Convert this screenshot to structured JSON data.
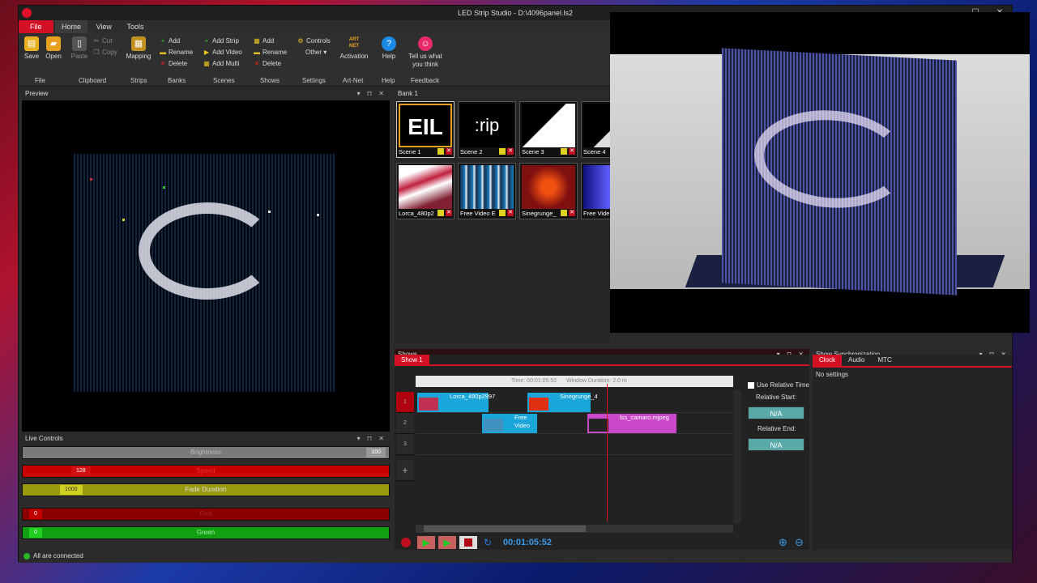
{
  "window": {
    "title": "LED Strip Studio - D:\\4096panel.ls2"
  },
  "menu": {
    "file": "File",
    "home": "Home",
    "view": "View",
    "tools": "Tools"
  },
  "ribbon": {
    "save": "Save",
    "open": "Open",
    "paste": "Paste",
    "cut": "Cut",
    "copy": "Copy",
    "mapping": "Mapping",
    "add_strip_bank": "Add",
    "rename_bank": "Rename",
    "delete_bank": "Delete",
    "add_strip": "Add Strip",
    "add_video": "Add Video",
    "add_multi": "Add Multi",
    "add_show": "Add",
    "rename_show": "Rename",
    "delete_show": "Delete",
    "controls": "Controls",
    "other": "Other",
    "activation": "Activation",
    "artnet_logo": "ART NET",
    "help": "Help",
    "feedback_l1": "Tell us what",
    "feedback_l2": "you think",
    "groups": [
      "File",
      "Clipboard",
      "Strips",
      "Banks",
      "Scenes",
      "Shows",
      "Settings",
      "Art-Net",
      "Help",
      "Feedback"
    ]
  },
  "preview": {
    "title": "Preview"
  },
  "live_controls": {
    "title": "Live Controls",
    "sliders": [
      {
        "label": "Brightness",
        "value": "100",
        "color": "#7a7a7a"
      },
      {
        "label": "Speed",
        "value": "128",
        "color": "#c80000"
      },
      {
        "label": "Fade Duration",
        "value": "1000",
        "color": "#9a9a10"
      },
      {
        "label": "Red",
        "value": "0",
        "color": "#8a0000"
      },
      {
        "label": "Green",
        "value": "0",
        "color": "#10a010"
      }
    ]
  },
  "bank": {
    "title": "Bank 1",
    "scenes": [
      "Scene 1",
      "Scene 2",
      "Scene 3",
      "Scene 4",
      "Lorca_480p2",
      "Free Video E",
      "Sinegrunge_",
      "Free Vide"
    ],
    "scene2_text": ":rip"
  },
  "shows": {
    "title": "Shows",
    "tab": "Show 1",
    "time_label": "Time: 00:01:05.52",
    "window_label": "Window Duration: 2.0 m",
    "tracks": [
      "1",
      "2",
      "3"
    ],
    "clips": [
      "Lorca_480p2997",
      "Sinegrunge_4",
      "Free Video",
      "lss_camaro.mjpeg"
    ],
    "add": "+",
    "timecode": "00:01:05:52",
    "use_relative_time": "Use Relative Time",
    "relative_start": "Relative Start:",
    "relative_end": "Relative End:",
    "na": "N/A"
  },
  "sync": {
    "title": "Show Synchronization",
    "tabs": [
      "Clock",
      "Audio",
      "MTC"
    ],
    "message": "No settings"
  },
  "status": {
    "text": "All are connected"
  }
}
